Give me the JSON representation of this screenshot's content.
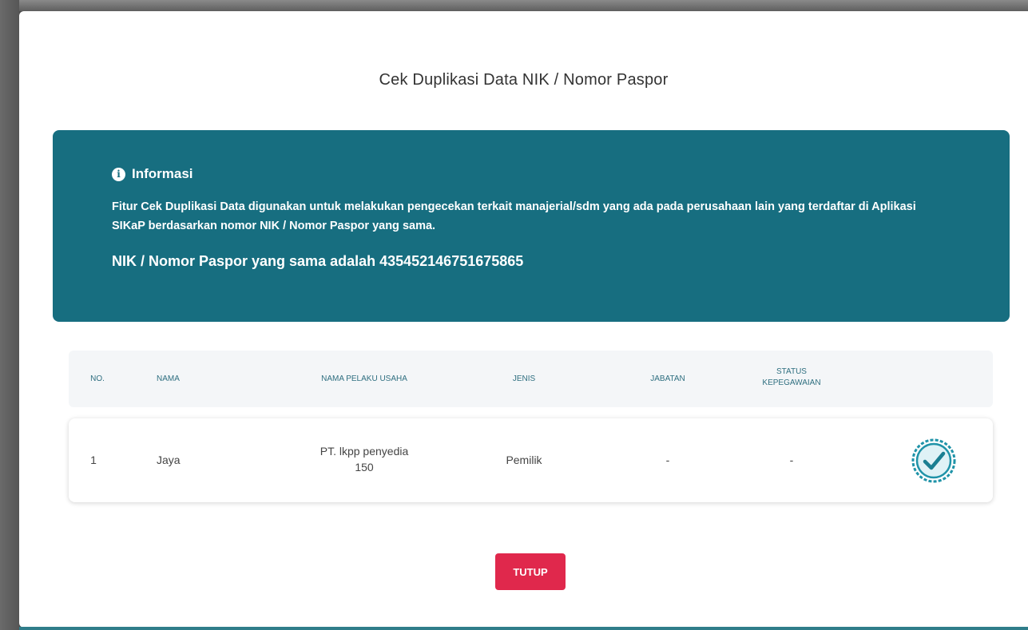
{
  "modal": {
    "title": "Cek Duplikasi Data NIK / Nomor Paspor",
    "close_button": "TUTUP"
  },
  "info": {
    "icon": "info-circle-icon",
    "heading": "Informasi",
    "text": "Fitur Cek Duplikasi Data digunakan untuk melakukan pengecekan terkait manajerial/sdm yang ada pada perusahaan lain yang terdaftar di Aplikasi SIKaP berdasarkan nomor NIK / Nomor Paspor yang sama.",
    "nik_line": "NIK / Nomor Paspor yang sama adalah 435452146751675865"
  },
  "table": {
    "headers": {
      "no": "NO.",
      "nama": "NAMA",
      "pelaku_usaha": "NAMA PELAKU USAHA",
      "jenis": "JENIS",
      "jabatan": "JABATAN",
      "status_line1": "STATUS",
      "status_line2": "KEPEGAWAIAN"
    },
    "rows": [
      {
        "no": "1",
        "nama": "Jaya",
        "pelaku_usaha_line1": "PT. lkpp penyedia",
        "pelaku_usaha_line2": "150",
        "jenis": "Pemilik",
        "jabatan": "-",
        "status": "-",
        "action_icon": "verified-check-icon"
      }
    ]
  },
  "colors": {
    "info_bg": "#176e80",
    "close_button_bg": "#e0284c",
    "header_text": "#2f6f80"
  }
}
